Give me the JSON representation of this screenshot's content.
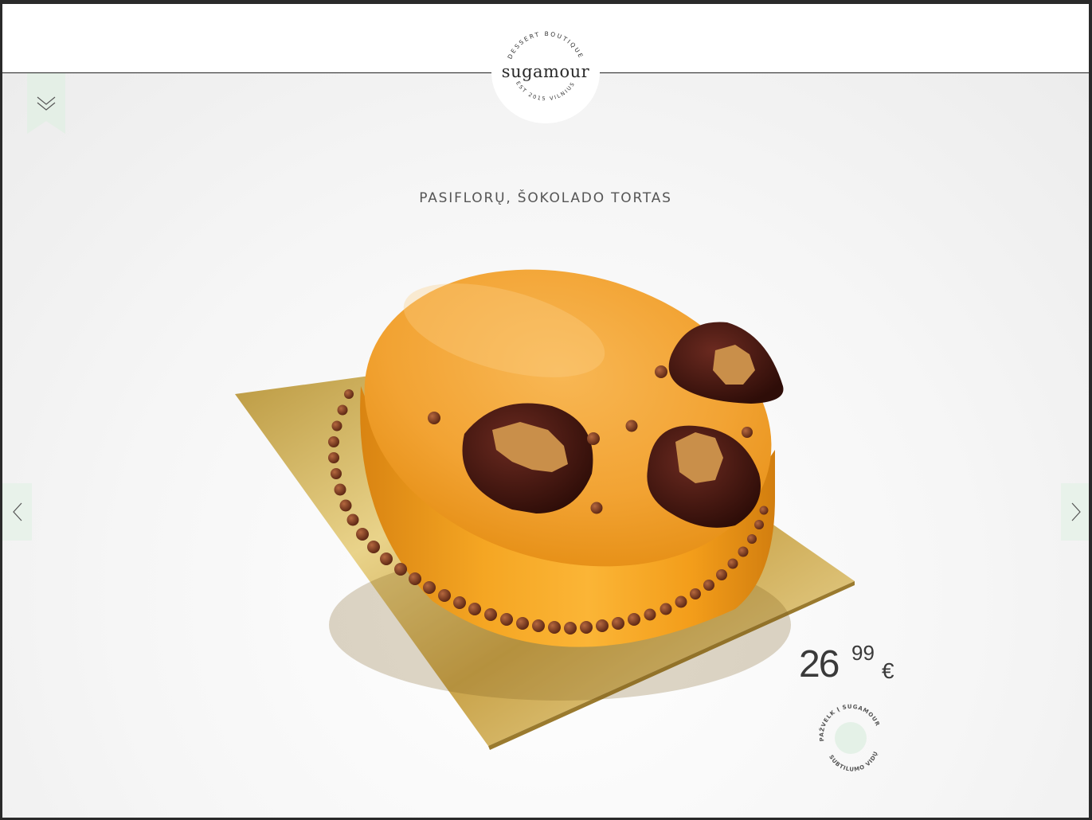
{
  "header": {
    "logo": {
      "name": "sugamour",
      "top_arc": "DESSERT BOUTIQUE",
      "bottom_arc": "EST 2015 VILNIUS"
    }
  },
  "menu": {
    "icon": "double-chevron-down-icon",
    "color": "#e4efe6"
  },
  "product": {
    "title": "PASIFLORŲ, ŠOKOLADO TORTAS",
    "price": {
      "main": "26",
      "cents": "99",
      "currency": "€"
    }
  },
  "navigation": {
    "prev_icon": "chevron-left-icon",
    "next_icon": "chevron-right-icon",
    "accent": "#e8f2ea"
  },
  "peek_badge": {
    "top_arc": "PAŽVELK Į SUGAMOUR",
    "bottom_arc": "SUBTILUMO VIDŲ",
    "fill": "#e4f1e7"
  }
}
